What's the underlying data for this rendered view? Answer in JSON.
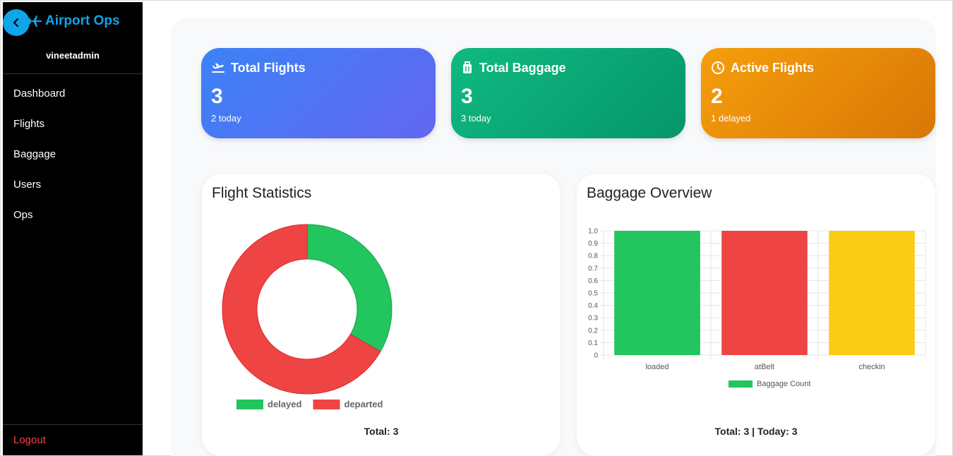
{
  "brand": {
    "name": "Airport Ops",
    "accent": "#0ea5e9"
  },
  "user": {
    "name": "vineetadmin"
  },
  "sidebar": {
    "items": [
      {
        "label": "Dashboard"
      },
      {
        "label": "Flights"
      },
      {
        "label": "Baggage"
      },
      {
        "label": "Users"
      },
      {
        "label": "Ops"
      }
    ],
    "logout": "Logout"
  },
  "cards": {
    "flights": {
      "title": "Total Flights",
      "value": "3",
      "sub": "2 today",
      "icon": "plane-departure-icon"
    },
    "baggage": {
      "title": "Total Baggage",
      "value": "3",
      "sub": "3 today",
      "icon": "luggage-icon"
    },
    "active": {
      "title": "Active Flights",
      "value": "2",
      "sub": "1 delayed",
      "icon": "clock-icon"
    }
  },
  "flight_stats": {
    "title": "Flight Statistics",
    "footer": "Total: 3"
  },
  "baggage_overview": {
    "title": "Baggage Overview",
    "footer": "Total: 3 | Today: 3"
  },
  "colors": {
    "green": "#22c55e",
    "red": "#ef4444",
    "yellow": "#facc15"
  },
  "chart_data": [
    {
      "type": "pie",
      "title": "Flight Statistics",
      "donut": true,
      "categories": [
        "delayed",
        "departed"
      ],
      "values": [
        1,
        2
      ],
      "colors": [
        "#22c55e",
        "#ef4444"
      ],
      "legend": "bottom"
    },
    {
      "type": "bar",
      "title": "Baggage Overview",
      "categories": [
        "loaded",
        "atBelt",
        "checkin"
      ],
      "series": [
        {
          "name": "Baggage Count",
          "values": [
            1,
            1,
            1
          ]
        }
      ],
      "colors": [
        "#22c55e",
        "#ef4444",
        "#facc15"
      ],
      "ylim": [
        0,
        1.0
      ],
      "yticks": [
        "0",
        "0.1",
        "0.2",
        "0.3",
        "0.4",
        "0.5",
        "0.6",
        "0.7",
        "0.8",
        "0.9",
        "1.0"
      ],
      "grid": true,
      "legend": "bottom"
    }
  ]
}
